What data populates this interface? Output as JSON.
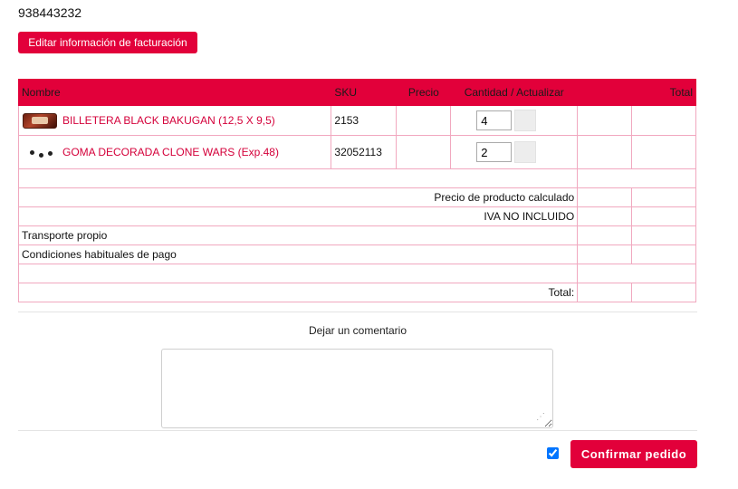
{
  "account": {
    "phone": "938443232"
  },
  "billing": {
    "edit_label": "Editar información de facturación"
  },
  "cart": {
    "headers": {
      "name": "Nombre",
      "sku": "SKU",
      "price": "Precio",
      "qty": "Cantidad / Actualizar",
      "total": "Total"
    },
    "items": [
      {
        "name": "BILLETERA BLACK BAKUGAN (12,5 X 9,5)",
        "sku": "2153",
        "quantity": "4",
        "thumb": "wallet-thumbnail"
      },
      {
        "name": "GOMA DECORADA CLONE WARS (Exp.48)",
        "sku": "32052113",
        "quantity": "2",
        "thumb": "eraser-thumbnail"
      }
    ],
    "summary": {
      "calculated_price": "Precio de producto calculado",
      "vat": "IVA NO INCLUIDO",
      "shipping": "Transporte propio",
      "payment": "Condiciones habituales de pago",
      "total": "Total:"
    }
  },
  "comment": {
    "label": "Dejar un comentario",
    "value": ""
  },
  "checkout": {
    "terms_checked": true,
    "confirm_label": "Confirmar pedido"
  },
  "colors": {
    "accent": "#e2003a",
    "border": "#f1a8bf"
  }
}
